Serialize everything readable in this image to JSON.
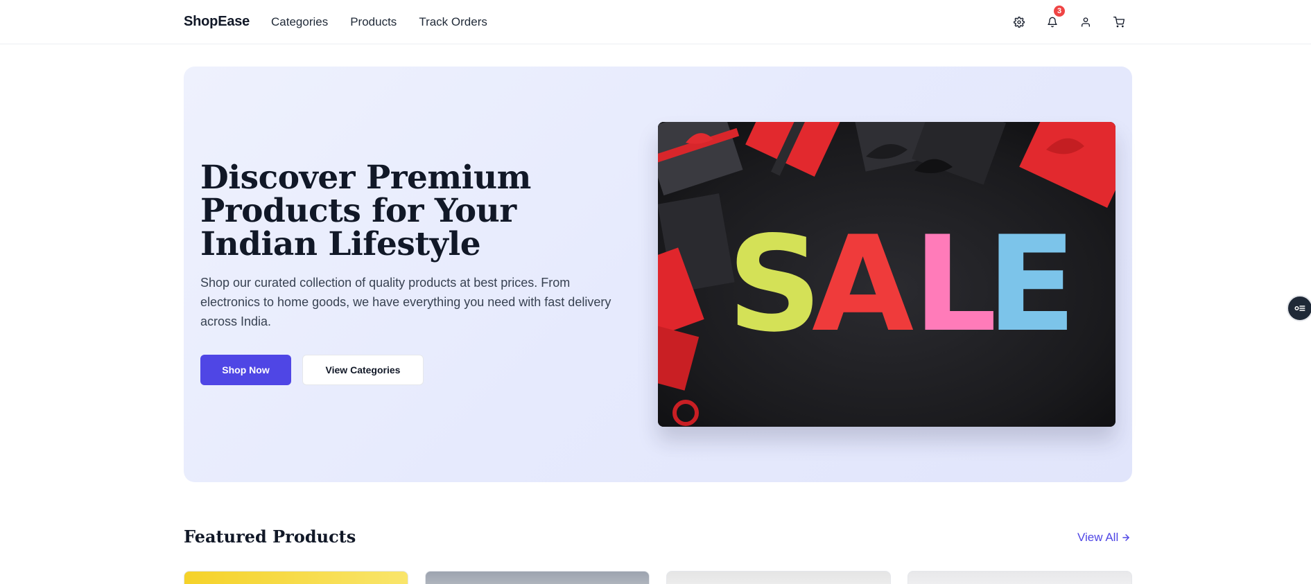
{
  "header": {
    "brand": "ShopEase",
    "nav": [
      {
        "label": "Categories"
      },
      {
        "label": "Products"
      },
      {
        "label": "Track Orders"
      }
    ],
    "icons": [
      "settings-icon",
      "bell-icon",
      "user-icon",
      "cart-icon"
    ],
    "notification_count": "3"
  },
  "hero": {
    "title": "Discover Premium Products for Your Indian Lifestyle",
    "description": "Shop our curated collection of quality products at best prices. From electronics to home goods, we have everything you need with fast delivery across India.",
    "primary_button": "Shop Now",
    "secondary_button": "View Categories",
    "image_text": "SALE"
  },
  "featured": {
    "title": "Featured Products",
    "view_all": "View All"
  },
  "colors": {
    "accent": "#4f46e5",
    "badge": "#ef4444",
    "hero_bg": "#e8ebfc",
    "sale_letters": [
      "#d4e157",
      "#ef3b3b",
      "#ff7bb9",
      "#7cc4ea"
    ]
  }
}
